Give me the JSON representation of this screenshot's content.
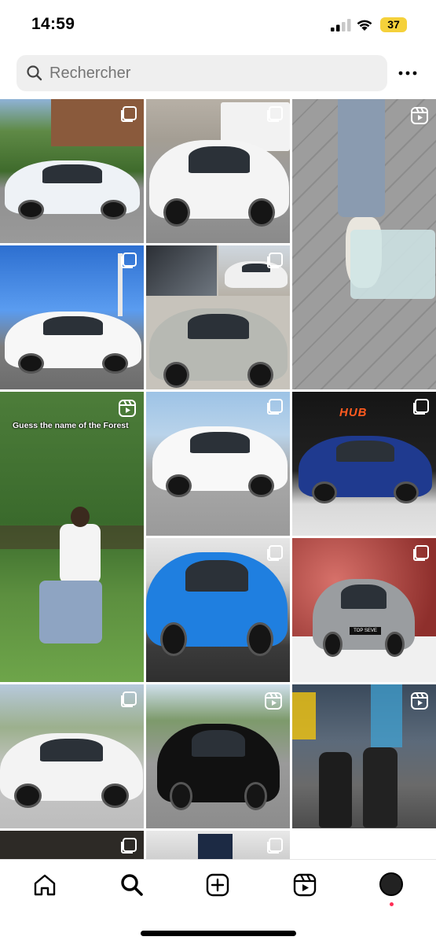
{
  "status_bar": {
    "time": "14:59",
    "battery": "37"
  },
  "search": {
    "placeholder": "Rechercher"
  },
  "grid": {
    "overlay_text": "Guess the name of the Forest",
    "hub_sign": "HUB",
    "plate_text": "TOP SEVE"
  },
  "nav": {
    "items": [
      "home-icon",
      "search-icon",
      "create-icon",
      "reels-icon",
      "profile-avatar"
    ]
  },
  "colors": {
    "accent_battery": "#f5d13b",
    "notification_dot": "#ff2d55"
  }
}
